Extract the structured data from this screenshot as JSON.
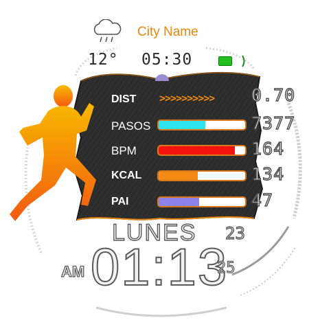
{
  "weather": {
    "city": "City Name",
    "temperature": "12°",
    "icon": "cloud-rain-icon"
  },
  "top_time": "05:30",
  "battery": {
    "icon": "battery-icon",
    "color": "#22c21e"
  },
  "metrics": [
    {
      "label": "DIST",
      "value": "0.70",
      "style": "bold"
    },
    {
      "label": "PASOS",
      "value": "7377",
      "style": "regular",
      "fill_fraction": 0.54,
      "color": "#2ee3ee"
    },
    {
      "label": "BPM",
      "value": "164",
      "style": "regular",
      "fill_fraction": 0.88,
      "color": "#f4140f"
    },
    {
      "label": "KCAL",
      "value": "134",
      "style": "bold",
      "fill_fraction": 0.45,
      "color": "#f28a14"
    },
    {
      "label": "PAI",
      "value": "47",
      "style": "bold",
      "fill_fraction": 0.47,
      "color": "#8a82e6"
    }
  ],
  "dist_chevrons": ">>>>>>>>>>",
  "day": "LUNES",
  "date": "23",
  "ampm": "AM",
  "time": "01:13",
  "seconds": "25",
  "colors": {
    "accent": "#e8860d",
    "panel": "#2b2b2b",
    "runner_top": "#f8b800",
    "runner_bottom": "#f25a12"
  }
}
